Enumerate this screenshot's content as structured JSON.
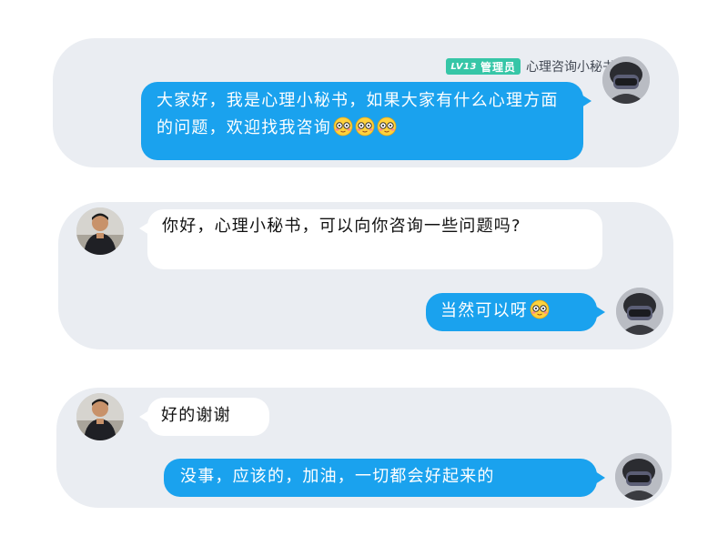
{
  "messages": {
    "m1": {
      "sender_level": "LV13",
      "sender_role": "管理员",
      "sender_name": "心理咨询小秘书",
      "text": "大家好，我是心理小秘书，如果大家有什么心理方面的问题，欢迎找我咨询"
    },
    "m2": {
      "text": "你好，心理小秘书，可以向你咨询一些问题吗?"
    },
    "m3": {
      "text": "当然可以呀"
    },
    "m4": {
      "text": "好的谢谢"
    },
    "m5": {
      "text": "没事，应该的，加油，一切都会好起来的"
    }
  },
  "colors": {
    "card_bg": "#eaedf2",
    "own_bubble": "#1aa2ee",
    "other_bubble": "#ffffff",
    "badge": "#36c6a7"
  },
  "icons": {
    "reaction_emoji": "blushing-face-with-glasses-icon",
    "avatar_self": "user-avatar-masked",
    "avatar_other": "user-avatar-man"
  }
}
